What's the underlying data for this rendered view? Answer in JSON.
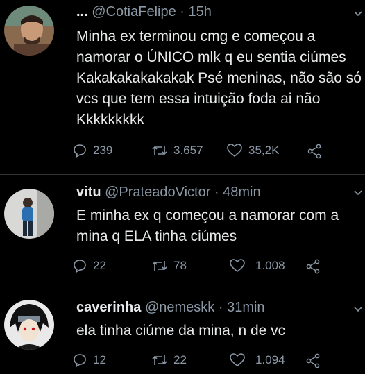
{
  "tweets": [
    {
      "prefix": "...",
      "name": "",
      "handle": "@CotiaFelipe",
      "time": "· 15h",
      "body": "Minha ex terminou cmg e começou a namorar o ÚNICO mlk q eu sentia ciúmes Kakakakakakakak Psé meninas, não são só vcs que tem essa intuição foda ai não Kkkkkkkkk",
      "replies": "239",
      "retweets": "3.657",
      "likes": "35,2K"
    },
    {
      "prefix": "",
      "name": "vitu",
      "handle": "@PrateadoVictor",
      "time": "· 48min",
      "body": "E minha ex q começou a namorar com a mina q ELA tinha ciúmes",
      "replies": "22",
      "retweets": "78",
      "likes": "1.008"
    },
    {
      "prefix": "",
      "name": "caverinha",
      "handle": "@nemeskk",
      "time": "· 31min",
      "body": "ela tinha ciúme da mina, n de vc",
      "replies": "12",
      "retweets": "22",
      "likes": "1.094"
    }
  ],
  "colors": {
    "background": "#000000",
    "text": "#e7e9ea",
    "muted": "#8b98a5",
    "divider": "#2f3336"
  },
  "icons": [
    "reply-icon",
    "retweet-icon",
    "like-icon",
    "share-icon",
    "chevron-down-icon"
  ]
}
